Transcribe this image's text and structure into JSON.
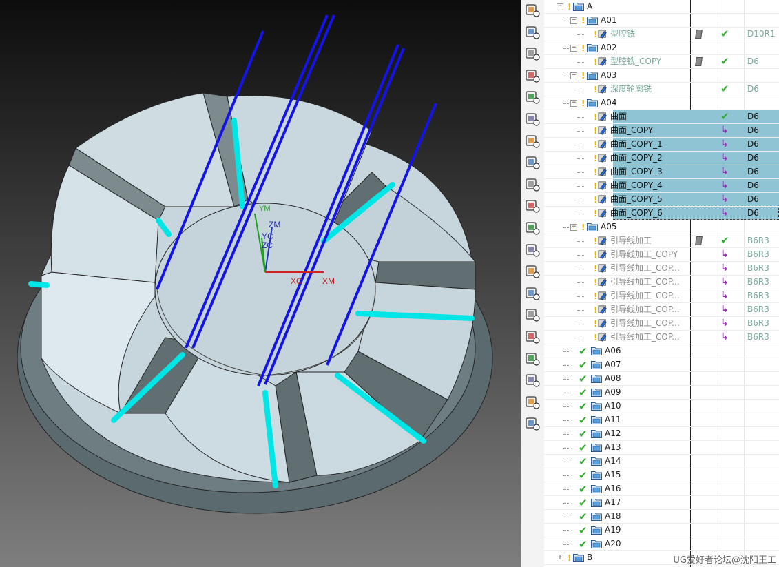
{
  "viewport": {
    "axis_labels": {
      "zm": "ZM",
      "yc": "YC",
      "zc": "ZC",
      "xc": "XC",
      "xm": "XM",
      "ym": "YM"
    }
  },
  "toolbar": {
    "buttons": [
      "create-program-icon",
      "create-tool-icon",
      "create-geometry-icon",
      "create-method-icon",
      "create-operation-icon",
      "verify-icon",
      "simulate-icon",
      "wrench-icon",
      "clamp-icon",
      "generate-toolpath-icon",
      "replay-toolpath-icon",
      "list-icon",
      "gouge-check-icon",
      "post-process-icon",
      "shop-doc-icon",
      "post-output-icon",
      "save-icon",
      "show-icon",
      "hide-icon",
      "ipw-icon"
    ]
  },
  "navigator": {
    "rows": [
      {
        "type": "group",
        "level": 0,
        "expander": "-",
        "label": "A"
      },
      {
        "type": "group",
        "level": 1,
        "expander": "-",
        "label": "A01"
      },
      {
        "type": "op",
        "level": 2,
        "label": "型腔铣",
        "pen": true,
        "status": "ok",
        "tool": "D10R1",
        "style": "gray"
      },
      {
        "type": "group",
        "level": 1,
        "expander": "-",
        "label": "A02"
      },
      {
        "type": "op",
        "level": 2,
        "label": "型腔铣_COPY",
        "pen": true,
        "status": "ok",
        "tool": "D6",
        "style": "gray"
      },
      {
        "type": "group",
        "level": 1,
        "expander": "-",
        "label": "A03"
      },
      {
        "type": "op",
        "level": 2,
        "label": "深度轮廓铣",
        "pen": false,
        "status": "ok",
        "tool": "D6",
        "style": "gray"
      },
      {
        "type": "group",
        "level": 1,
        "expander": "-",
        "label": "A04"
      },
      {
        "type": "op",
        "level": 2,
        "label": "曲面",
        "status": "ok",
        "tool": "D6",
        "selected": true
      },
      {
        "type": "op",
        "level": 2,
        "label": "曲面_COPY",
        "status": "re",
        "tool": "D6",
        "selected": true
      },
      {
        "type": "op",
        "level": 2,
        "label": "曲面_COPY_1",
        "status": "re",
        "tool": "D6",
        "selected": true
      },
      {
        "type": "op",
        "level": 2,
        "label": "曲面_COPY_2",
        "status": "re",
        "tool": "D6",
        "selected": true
      },
      {
        "type": "op",
        "level": 2,
        "label": "曲面_COPY_3",
        "status": "re",
        "tool": "D6",
        "selected": true
      },
      {
        "type": "op",
        "level": 2,
        "label": "曲面_COPY_4",
        "status": "re",
        "tool": "D6",
        "selected": true
      },
      {
        "type": "op",
        "level": 2,
        "label": "曲面_COPY_5",
        "status": "re",
        "tool": "D6",
        "selected": true
      },
      {
        "type": "op",
        "level": 2,
        "label": "曲面_COPY_6",
        "status": "re",
        "tool": "D6",
        "selected": true,
        "last": true
      },
      {
        "type": "group",
        "level": 1,
        "expander": "-",
        "label": "A05"
      },
      {
        "type": "op",
        "level": 2,
        "label": "引导线加工",
        "pen": true,
        "status": "ok",
        "tool": "B6R3",
        "style": "dim"
      },
      {
        "type": "op",
        "level": 2,
        "label": "引导线加工_COPY",
        "status": "re",
        "tool": "B6R3",
        "style": "dim"
      },
      {
        "type": "op",
        "level": 2,
        "label": "引导线加工_COP...",
        "status": "re",
        "tool": "B6R3",
        "style": "dim"
      },
      {
        "type": "op",
        "level": 2,
        "label": "引导线加工_COP...",
        "status": "re",
        "tool": "B6R3",
        "style": "dim"
      },
      {
        "type": "op",
        "level": 2,
        "label": "引导线加工_COP...",
        "status": "re",
        "tool": "B6R3",
        "style": "dim"
      },
      {
        "type": "op",
        "level": 2,
        "label": "引导线加工_COP...",
        "status": "re",
        "tool": "B6R3",
        "style": "dim"
      },
      {
        "type": "op",
        "level": 2,
        "label": "引导线加工_COP...",
        "status": "re",
        "tool": "B6R3",
        "style": "dim"
      },
      {
        "type": "op",
        "level": 2,
        "label": "引导线加工_COP...",
        "status": "re",
        "tool": "B6R3",
        "style": "dim"
      },
      {
        "type": "done",
        "level": 1,
        "label": "A06"
      },
      {
        "type": "done",
        "level": 1,
        "label": "A07"
      },
      {
        "type": "done",
        "level": 1,
        "label": "A08"
      },
      {
        "type": "done",
        "level": 1,
        "label": "A09"
      },
      {
        "type": "done",
        "level": 1,
        "label": "A10"
      },
      {
        "type": "done",
        "level": 1,
        "label": "A11"
      },
      {
        "type": "done",
        "level": 1,
        "label": "A12"
      },
      {
        "type": "done",
        "level": 1,
        "label": "A13"
      },
      {
        "type": "done",
        "level": 1,
        "label": "A14"
      },
      {
        "type": "done",
        "level": 1,
        "label": "A15"
      },
      {
        "type": "done",
        "level": 1,
        "label": "A16"
      },
      {
        "type": "done",
        "level": 1,
        "label": "A17"
      },
      {
        "type": "done",
        "level": 1,
        "label": "A18"
      },
      {
        "type": "done",
        "level": 1,
        "label": "A19"
      },
      {
        "type": "done",
        "level": 1,
        "label": "A20"
      },
      {
        "type": "group",
        "level": 0,
        "expander": "+",
        "label": "B"
      }
    ]
  },
  "watermark": "UG爱好者论坛@沈阳王工",
  "colors": {
    "selection": "#8fc4d4",
    "ok": "#2eaa2e",
    "regen": "#9a2fb8",
    "toolpath": "#1010e0",
    "cutter": "#00e5e5"
  }
}
